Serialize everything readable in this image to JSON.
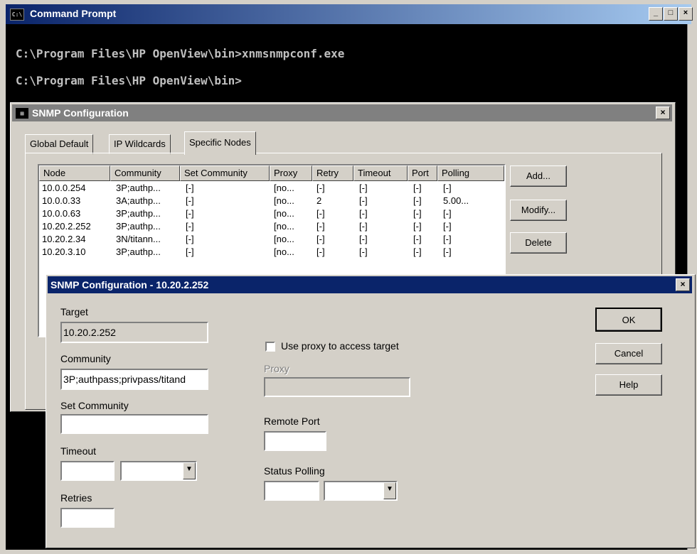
{
  "cmd": {
    "title": "Command Prompt",
    "lines": [
      "C:\\Program Files\\HP OpenView\\bin>xnmsnmpconf.exe",
      "C:\\Program Files\\HP OpenView\\bin>"
    ]
  },
  "snmp": {
    "title": "SNMP Configuration",
    "tabs": [
      "Global Default",
      "IP Wildcards",
      "Specific Nodes"
    ],
    "active_tab": "Specific Nodes",
    "columns": [
      "Node",
      "Community",
      "Set Community",
      "Proxy",
      "Retry",
      "Timeout",
      "Port",
      "Polling"
    ],
    "rows": [
      [
        "10.0.0.254",
        "3P;authp...",
        "[-]",
        "[no...",
        "[-]",
        "[-]",
        "[-]",
        "[-]"
      ],
      [
        "10.0.0.33",
        "3A;authp...",
        "[-]",
        "[no...",
        "2",
        "[-]",
        "[-]",
        "5.00..."
      ],
      [
        "10.0.0.63",
        "3P;authp...",
        "[-]",
        "[no...",
        "[-]",
        "[-]",
        "[-]",
        "[-]"
      ],
      [
        "10.20.2.252",
        "3P;authp...",
        "[-]",
        "[no...",
        "[-]",
        "[-]",
        "[-]",
        "[-]"
      ],
      [
        "10.20.2.34",
        "3N/titann...",
        "[-]",
        "[no...",
        "[-]",
        "[-]",
        "[-]",
        "[-]"
      ],
      [
        "10.20.3.10",
        "3P;authp...",
        "[-]",
        "[no...",
        "[-]",
        "[-]",
        "[-]",
        "[-]"
      ]
    ],
    "buttons": {
      "add": "Add...",
      "modify": "Modify...",
      "delete": "Delete"
    }
  },
  "dialog": {
    "title": "SNMP Configuration - 10.20.2.252",
    "target_label": "Target",
    "target_value": "10.20.2.252",
    "community_label": "Community",
    "community_value": "3P;authpass;privpass/titand",
    "set_community_label": "Set Community",
    "set_community_value": "",
    "timeout_label": "Timeout",
    "retries_label": "Retries",
    "use_proxy_label": "Use proxy to access target",
    "use_proxy_checked": false,
    "proxy_label": "Proxy",
    "remote_port_label": "Remote Port",
    "status_polling_label": "Status Polling",
    "buttons": {
      "ok": "OK",
      "cancel": "Cancel",
      "help": "Help"
    }
  }
}
